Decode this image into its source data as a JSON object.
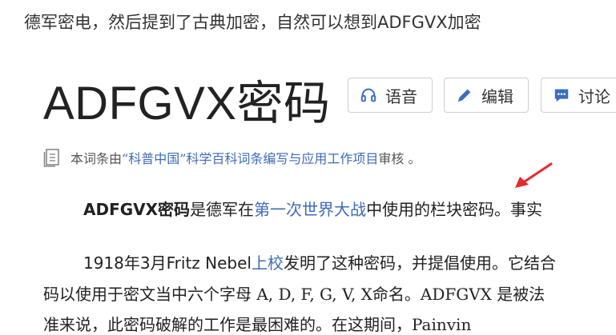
{
  "top_text": "德军密电，然后提到了古典加密，自然可以想到ADFGVX加密",
  "title": "ADFGVX密码",
  "buttons": {
    "audio": "语音",
    "edit": "编辑",
    "discuss": "讨论"
  },
  "review": {
    "prefix": "本词条由",
    "link": "“科普中国”科学百科词条编写与应用工作项目",
    "suffix": " 审核 。"
  },
  "paragraph1": {
    "bold_term": "ADFGVX密码",
    "text_a": "是德军在",
    "link": "第一次世界大战",
    "text_b": "中使用的栏块密码。事实"
  },
  "paragraph2": {
    "text_a": "1918年3月Fritz Nebel",
    "link": "上校",
    "text_b": "发明了这种密码，并提倡使用。它结合"
  },
  "paragraph3": "码以使用于密文当中六个字母 A, D, F, G, V, X命名。ADFGVX 是被法",
  "paragraph4": "准来说，此密码破解的工作是最困难的。在这期间，Painvin"
}
